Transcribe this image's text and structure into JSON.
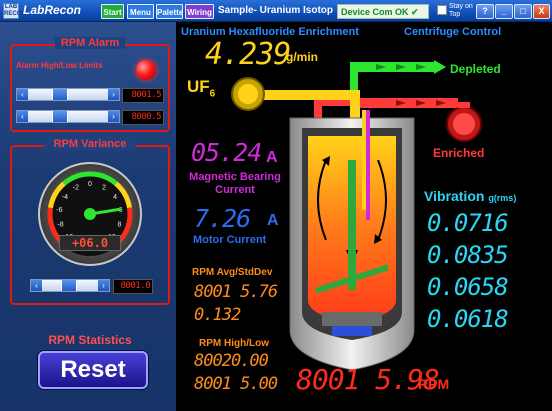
{
  "titlebar": {
    "logo_text": "LAB RECON",
    "app_title": "LabRecon",
    "buttons": {
      "start": "Start",
      "menu": "Menu",
      "palette": "Palette",
      "wiring": "Wiring"
    },
    "sample_title": "Sample- Uranium Isotop",
    "device_status": "Device Com OK",
    "stay_on_top_label": "Stay on Top",
    "window_buttons": {
      "help": "?",
      "minimize": "_",
      "maximize": "□",
      "close": "X"
    }
  },
  "rpm_alarm": {
    "title": "RPM Alarm",
    "limits_label": "Alarm High/Low Limits",
    "high_limit": "8001.5",
    "low_limit": "8000.5",
    "high_slider_level": 0.38,
    "low_slider_level": 0.38
  },
  "rpm_variance": {
    "title": "RPM Variance",
    "gauge_ticks": [
      "-10",
      "-8",
      "-6",
      "-4",
      "-2",
      "0",
      "2",
      "4",
      "6",
      "8",
      "10"
    ],
    "gauge_readout": "+06.0",
    "gauge_value": 6,
    "setpoint": "8001.0",
    "slider_level": 0.48
  },
  "rpm_statistics": {
    "title": "RPM Statistics",
    "reset_label": "Reset"
  },
  "header": {
    "left": "Uranium Hexafluoride Enrichment",
    "right": "Centrifuge Control"
  },
  "feed": {
    "value": "4.239",
    "unit": "g/min",
    "label_main": "UF",
    "label_sub": "6"
  },
  "flows": {
    "depleted": "Depleted",
    "enriched": "Enriched"
  },
  "magnetic_bearing": {
    "value": "05.24",
    "unit": "A",
    "label": "Magnetic Bearing Current"
  },
  "motor": {
    "value": "7.26",
    "unit": "A",
    "label": "Motor Current"
  },
  "vibration": {
    "title": "Vibration",
    "unit": "g(rms)",
    "values": [
      "0.0716",
      "0.0835",
      "0.0658",
      "0.0618"
    ]
  },
  "stats": {
    "avg_label": "RPM Avg/StdDev",
    "avg": "8001 5.76",
    "std": "0.132",
    "hl_label": "RPM High/Low",
    "high": "80020.00",
    "low": "8001 5.00"
  },
  "rpm": {
    "value": "8001 5.98",
    "unit": "RPM"
  },
  "colors": {
    "accent_red": "#e01818",
    "lcd_red": "#ff2a1a",
    "yellow": "#ffd21a",
    "green": "#2ee62e",
    "magenta": "#d12ad8",
    "blue": "#2a6cf0",
    "cyan": "#2ad6f5",
    "orange": "#ff8c1a"
  }
}
